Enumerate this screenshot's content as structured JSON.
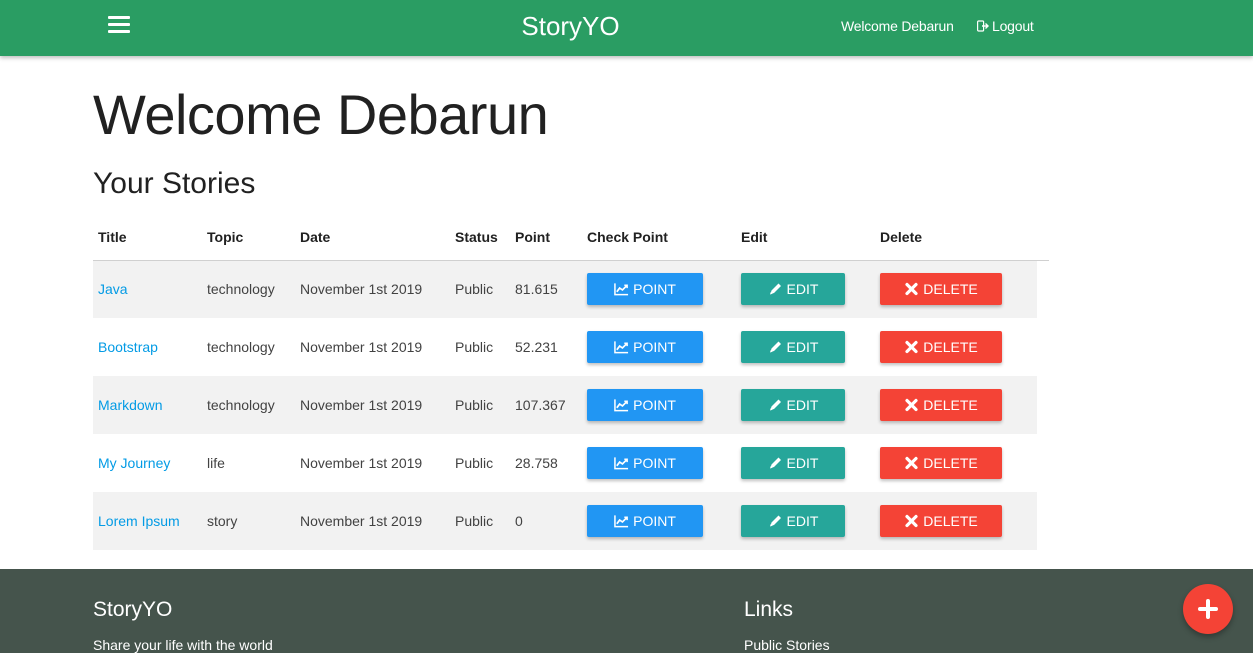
{
  "navbar": {
    "brand": "StoryYO",
    "welcome": "Welcome Debarun",
    "logout": "Logout"
  },
  "main": {
    "heading": "Welcome Debarun",
    "section_title": "Your Stories",
    "columns": [
      "Title",
      "Topic",
      "Date",
      "Status",
      "Point",
      "Check Point",
      "Edit",
      "Delete"
    ],
    "stories": [
      {
        "title": "Java",
        "topic": "technology",
        "date": "November 1st 2019",
        "status": "Public",
        "point": "81.615"
      },
      {
        "title": "Bootstrap",
        "topic": "technology",
        "date": "November 1st 2019",
        "status": "Public",
        "point": "52.231"
      },
      {
        "title": "Markdown",
        "topic": "technology",
        "date": "November 1st 2019",
        "status": "Public",
        "point": "107.367"
      },
      {
        "title": "My Journey",
        "topic": "life",
        "date": "November 1st 2019",
        "status": "Public",
        "point": "28.758"
      },
      {
        "title": "Lorem Ipsum",
        "topic": "story",
        "date": "November 1st 2019",
        "status": "Public",
        "point": "0"
      }
    ],
    "buttons": {
      "point": "POINT",
      "edit": "EDIT",
      "delete": "DELETE"
    }
  },
  "footer": {
    "title": "StoryYO",
    "tagline": "Share your life with the world",
    "links_title": "Links",
    "links": [
      "Public Stories"
    ]
  },
  "icons": {
    "menu": "hamburger-menu-icon",
    "logout": "sign-out-icon",
    "point": "line-chart-icon",
    "edit": "pencil-icon",
    "delete": "times-icon",
    "fab": "plus-icon"
  },
  "colors": {
    "navbar": "#2a9d63",
    "link": "#039be5",
    "point_button": "#2196f3",
    "edit_button": "#26a69a",
    "delete_button": "#f44336",
    "footer": "#45544c"
  }
}
